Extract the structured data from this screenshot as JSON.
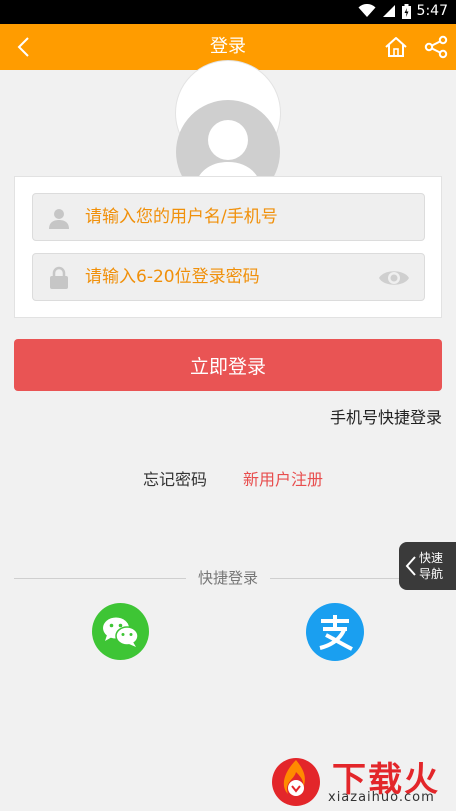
{
  "status_bar": {
    "time": "5:47"
  },
  "header": {
    "title": "登录"
  },
  "form": {
    "username_placeholder": "请输入您的用户名/手机号",
    "password_placeholder": "请输入6-20位登录密码"
  },
  "login_button": "立即登录",
  "phone_quick_login": "手机号快捷登录",
  "links": {
    "forgot": "忘记密码",
    "register": "新用户注册"
  },
  "quick_login_label": "快捷登录",
  "side_nav": {
    "line1": "快速",
    "line2": "导航"
  },
  "watermark": {
    "brand": "下载火",
    "domain": "xiazaihuo.com"
  },
  "colors": {
    "header": "#ff9c00",
    "login_button": "#e95454",
    "register_link": "#e84e4e",
    "placeholder": "#f0900a",
    "wechat": "#3ec535",
    "alipay": "#1a9ff0"
  }
}
